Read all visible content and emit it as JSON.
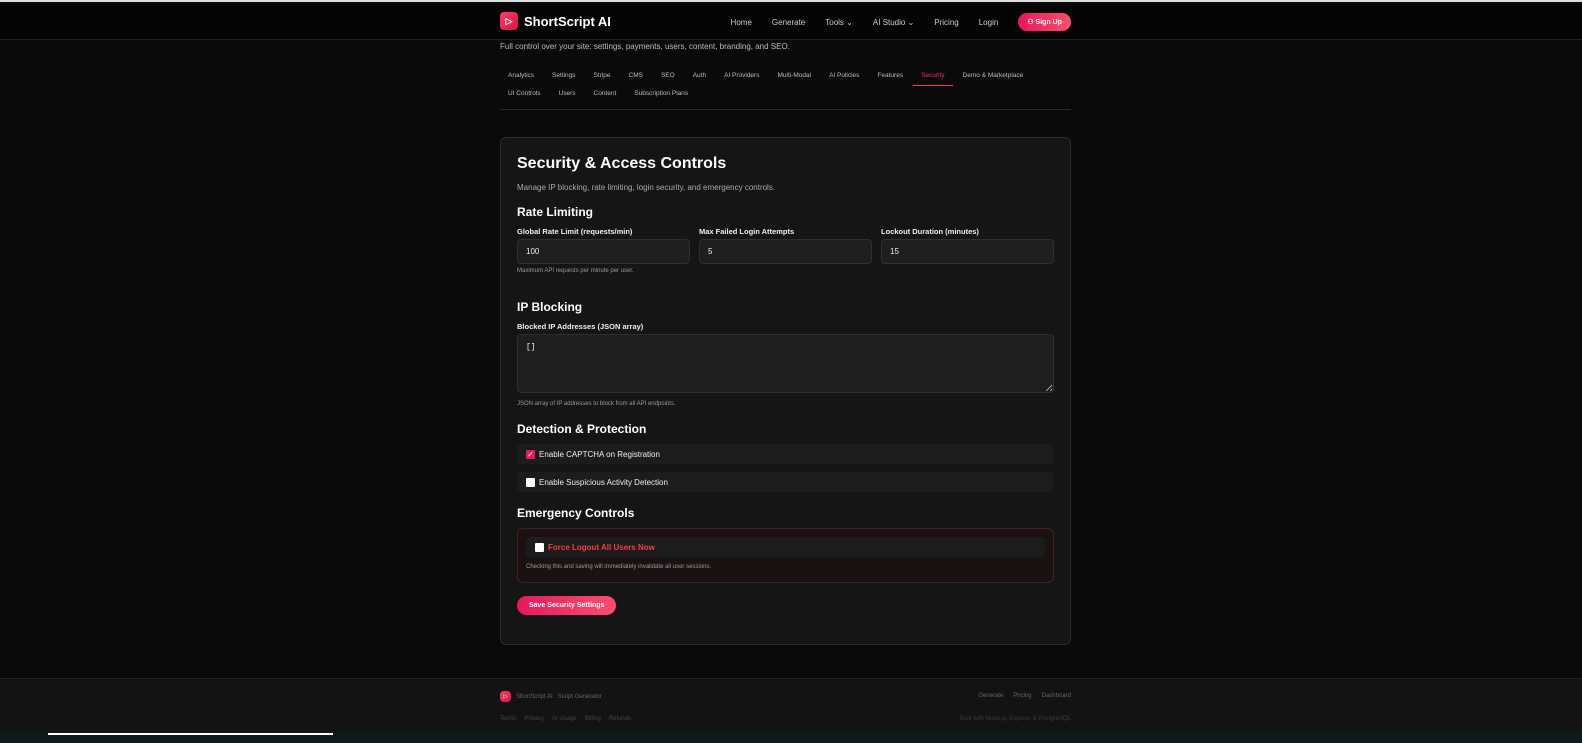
{
  "brand": "ShortScript AI",
  "nav": {
    "items": [
      "Home",
      "Generate",
      "Tools",
      "AI Studio",
      "Pricing",
      "Login"
    ],
    "signup": "Sign Up"
  },
  "subtitle": "Full control over your site: settings, payments, users, content, branding, and SEO.",
  "tabs": [
    "Analytics",
    "Settings",
    "Stripe",
    "CMS",
    "SEO",
    "Auth",
    "AI Providers",
    "Multi-Modal",
    "AI Policies",
    "Features",
    "Security",
    "Demo & Marketplace",
    "UI Controls",
    "Users",
    "Content",
    "Subscription Plans"
  ],
  "card": {
    "title": "Security & Access Controls",
    "description": "Manage IP blocking, rate limiting, login security, and emergency controls.",
    "rate": {
      "heading": "Rate Limiting",
      "global_label": "Global Rate Limit (requests/min)",
      "global_value": "100",
      "global_help": "Maximum API requests per minute per user.",
      "failed_label": "Max Failed Login Attempts",
      "failed_value": "5",
      "lockout_label": "Lockout Duration (minutes)",
      "lockout_value": "15"
    },
    "ip": {
      "heading": "IP Blocking",
      "label": "Blocked IP Addresses (JSON array)",
      "value": "[]",
      "help": "JSON array of IP addresses to block from all API endpoints."
    },
    "detect": {
      "heading": "Detection & Protection",
      "captcha": "Enable CAPTCHA on Registration",
      "suspicious": "Enable Suspicious Activity Detection"
    },
    "emergency": {
      "heading": "Emergency Controls",
      "force": "Force Logout All Users Now",
      "help": "Checking this and saving will immediately invalidate all user sessions."
    },
    "save": "Save Security Settings"
  },
  "footer": {
    "brand": "ShortScript AI",
    "tagline": "Script Generator",
    "right_links": [
      "Generate",
      "Pricing",
      "Dashboard"
    ],
    "links": [
      "Terms",
      "Privacy",
      "AI Usage",
      "Billing",
      "Refunds"
    ],
    "built": "Built with Node.js, Express & PostgreSQL"
  }
}
